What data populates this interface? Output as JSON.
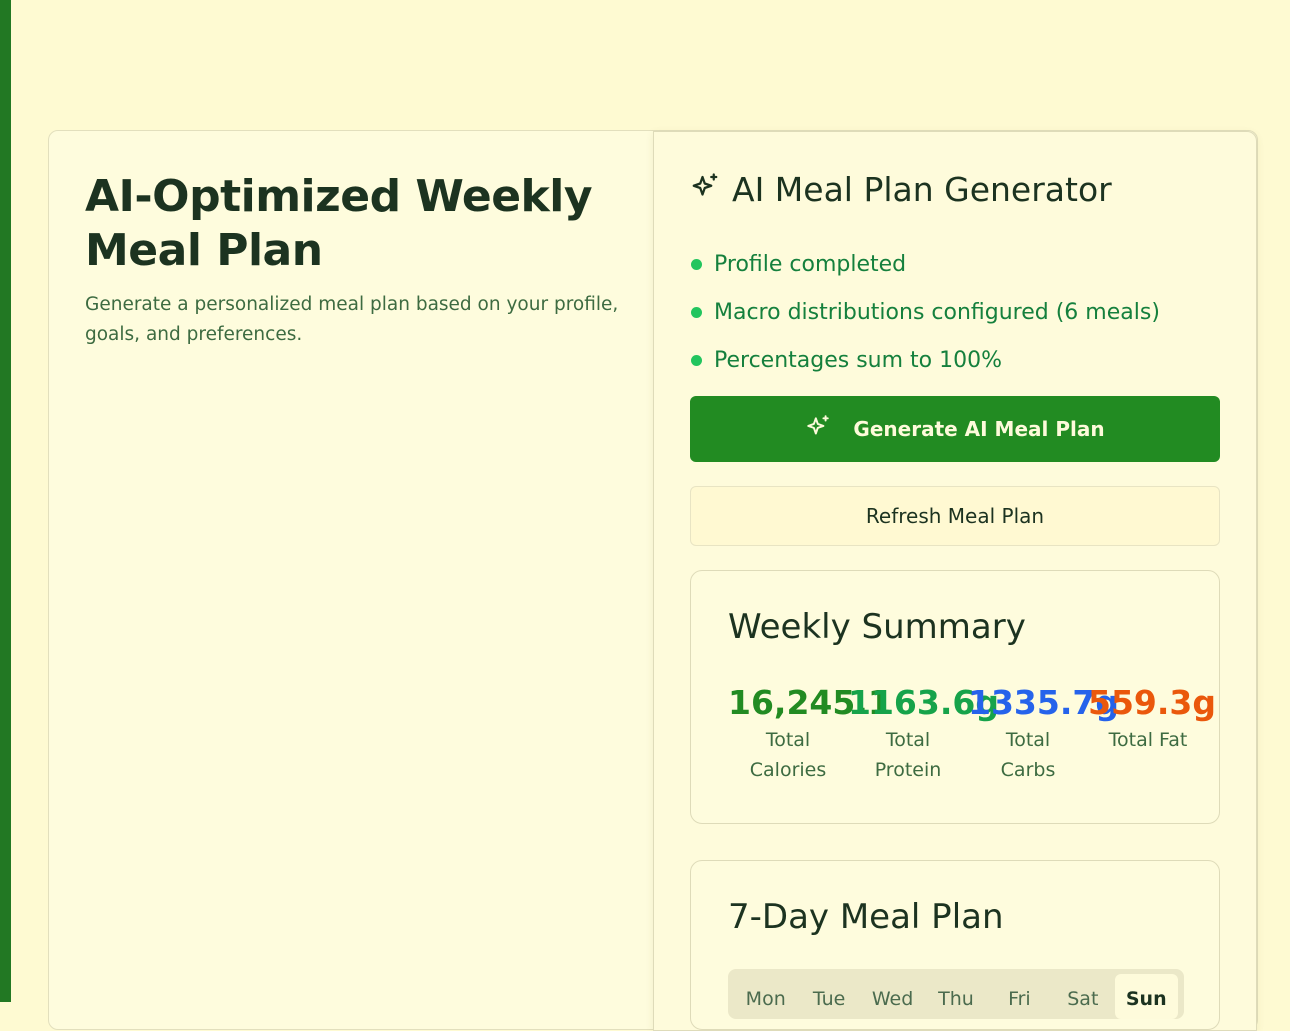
{
  "intro": {
    "title": "AI-Optimized Weekly Meal Plan",
    "subtitle": "Generate a personalized meal plan based on your profile, goals, and preferences."
  },
  "generator": {
    "title": "AI Meal Plan Generator",
    "icon": "sparkles-icon",
    "checks": [
      {
        "label": "Profile completed"
      },
      {
        "label": "Macro distributions configured (6 meals)"
      },
      {
        "label": "Percentages sum to 100%"
      }
    ],
    "generate_label": "Generate AI Meal Plan",
    "refresh_label": "Refresh Meal Plan"
  },
  "summary": {
    "title": "Weekly Summary",
    "stats": [
      {
        "value": "16,245.1",
        "label": "Total Calories",
        "color": "#228b22"
      },
      {
        "value": "1163.6g",
        "label": "Total Protein",
        "color": "#16a34a"
      },
      {
        "value": "1335.7g",
        "label": "Total Carbs",
        "color": "#2563eb"
      },
      {
        "value": "559.3g",
        "label": "Total Fat",
        "color": "#ea580c"
      }
    ]
  },
  "plan": {
    "title": "7-Day Meal Plan",
    "tabs": [
      "Mon",
      "Tue",
      "Wed",
      "Thu",
      "Fri",
      "Sat",
      "Sun"
    ],
    "active_tab": "Sun"
  },
  "colors": {
    "accent": "#228b22",
    "background": "#fefad2",
    "check_text": "#15803d"
  }
}
